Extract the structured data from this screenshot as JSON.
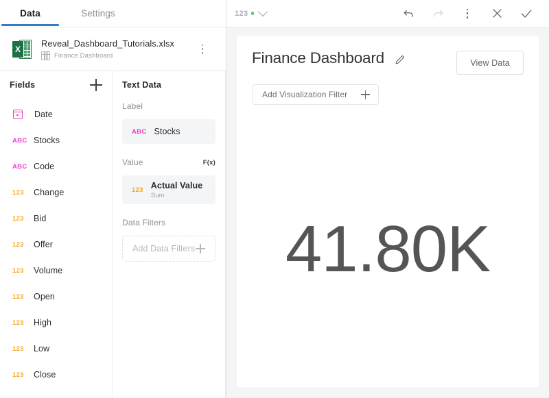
{
  "tabs": [
    {
      "id": "data",
      "label": "Data",
      "active": true
    },
    {
      "id": "settings",
      "label": "Settings",
      "active": false
    }
  ],
  "file": {
    "name": "Reveal_Dashboard_Tutorials.xlsx",
    "sheet": "Finance Dashboard",
    "icon": "excel-file-icon",
    "sheet_icon": "table-icon",
    "menu_icon": "kebab-menu-icon"
  },
  "fields_panel": {
    "title": "Fields",
    "add_icon": "plus-icon",
    "items": [
      {
        "label": "Date",
        "type": "date",
        "type_label": ""
      },
      {
        "label": "Stocks",
        "type": "text",
        "type_label": "ABC"
      },
      {
        "label": "Code",
        "type": "text",
        "type_label": "ABC"
      },
      {
        "label": "Change",
        "type": "number",
        "type_label": "123"
      },
      {
        "label": "Bid",
        "type": "number",
        "type_label": "123"
      },
      {
        "label": "Offer",
        "type": "number",
        "type_label": "123"
      },
      {
        "label": "Volume",
        "type": "number",
        "type_label": "123"
      },
      {
        "label": "Open",
        "type": "number",
        "type_label": "123"
      },
      {
        "label": "High",
        "type": "number",
        "type_label": "123"
      },
      {
        "label": "Low",
        "type": "number",
        "type_label": "123"
      },
      {
        "label": "Close",
        "type": "number",
        "type_label": "123"
      }
    ]
  },
  "properties_panel": {
    "title": "Text Data",
    "label_section": {
      "heading": "Label",
      "chip": {
        "type_label": "ABC",
        "name": "Stocks"
      }
    },
    "value_section": {
      "heading": "Value",
      "formula_label": "F(x)",
      "chip": {
        "type_label": "123",
        "name": "Actual Value",
        "aggregation": "Sum"
      }
    },
    "filters_section": {
      "heading": "Data Filters",
      "placeholder": "Add Data Filters",
      "add_icon": "plus-icon"
    }
  },
  "toolbar": {
    "viz_type_label": "123",
    "viz_type_dot_color": "#57c878",
    "viz_dropdown_icon": "chevron-down-icon",
    "undo_label": "Undo",
    "undo_icon": "undo-arrow-icon",
    "redo_label": "Redo",
    "redo_icon": "redo-arrow-icon",
    "more_label": "More options",
    "more_icon": "kebab-menu-icon",
    "cancel_label": "Cancel",
    "cancel_icon": "close-x-icon",
    "confirm_label": "Done",
    "confirm_icon": "checkmark-icon"
  },
  "visualization": {
    "title": "Finance Dashboard",
    "edit_icon": "pencil-icon",
    "view_data_label": "View Data",
    "add_filter_label": "Add Visualization Filter",
    "add_filter_icon": "plus-icon",
    "kpi_value": "41.80K"
  },
  "colors": {
    "accent_blue": "#3879c5",
    "text_field_pink": "#ef3fc8",
    "number_field_orange": "#f5a623",
    "excel_green": "#1e7145",
    "kpi_gray": "#555555",
    "canvas_gray": "#f5f5f6"
  }
}
